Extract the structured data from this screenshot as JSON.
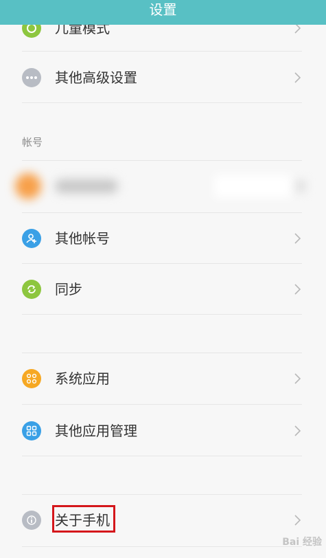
{
  "header": {
    "title": "设置"
  },
  "rows": {
    "child_mode": "儿童模式",
    "advanced": "其他高级设置",
    "other_accounts": "其他帐号",
    "sync": "同步",
    "system_apps": "系统应用",
    "other_app_mgmt": "其他应用管理",
    "about_phone": "关于手机"
  },
  "sections": {
    "account": "帐号"
  },
  "icons": {
    "child_mode": "child-mode-icon",
    "advanced": "more-dots-icon",
    "account_avatar": "mi-account-icon",
    "other_accounts": "add-person-icon",
    "sync": "sync-icon",
    "system_apps": "apps-grid-icon",
    "other_app_mgmt": "app-management-icon",
    "about_phone": "info-icon"
  },
  "colors": {
    "header": "#58c0c4",
    "green": "#8dc63f",
    "grey": "#b8bcc4",
    "blue": "#3aa0e6",
    "orange": "#f6a823",
    "highlight": "#d4161b"
  },
  "watermark": "Bai 经验"
}
